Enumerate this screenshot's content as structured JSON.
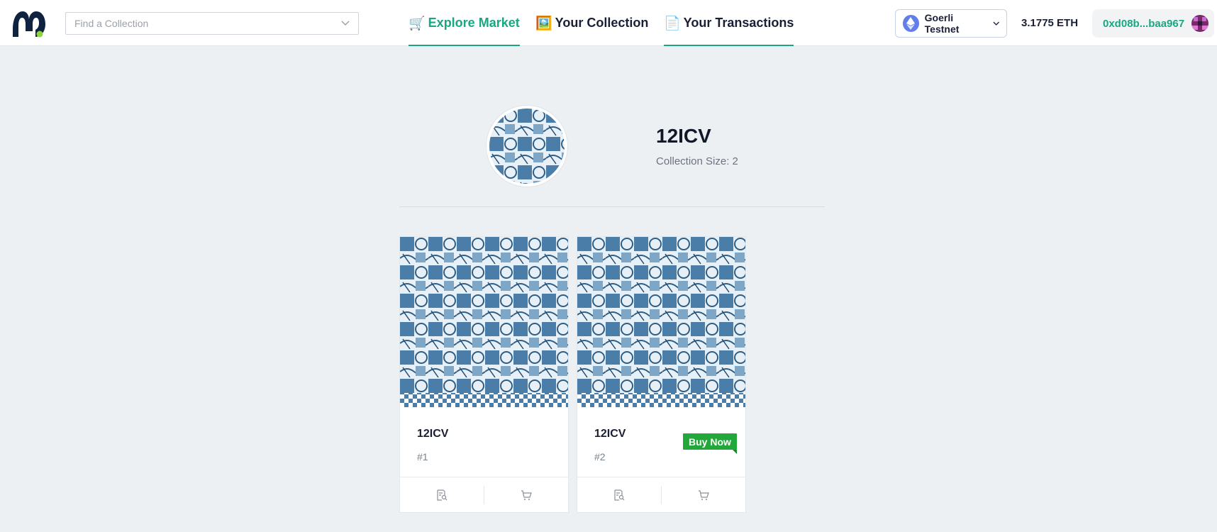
{
  "header": {
    "search_placeholder": "Find a Collection",
    "nav": [
      {
        "emoji": "🛒",
        "label": "Explore Market",
        "active": true
      },
      {
        "emoji": "🖼️",
        "label": "Your Collection",
        "active": false
      },
      {
        "emoji": "📄",
        "label": "Your Transactions",
        "active": false
      }
    ],
    "network_label": "Goerli Testnet",
    "balance": "3.1775 ETH",
    "account_address": "0xd08b...baa967"
  },
  "collection": {
    "name": "12ICV",
    "size_text": "Collection Size: 2"
  },
  "items": [
    {
      "title": "12ICV",
      "token": "#1",
      "buy_now": null
    },
    {
      "title": "12ICV",
      "token": "#2",
      "buy_now": "Buy Now"
    }
  ],
  "colors": {
    "accent": "#17a883",
    "buy_now": "#22a83a",
    "eth": "#627eea",
    "art_blue": "#4a7ea8"
  },
  "icons": {
    "logo": "m-logo-icon",
    "dropdown": "chevron-down-icon",
    "network": "ethereum-icon",
    "details": "document-search-icon",
    "cart": "cart-icon"
  }
}
